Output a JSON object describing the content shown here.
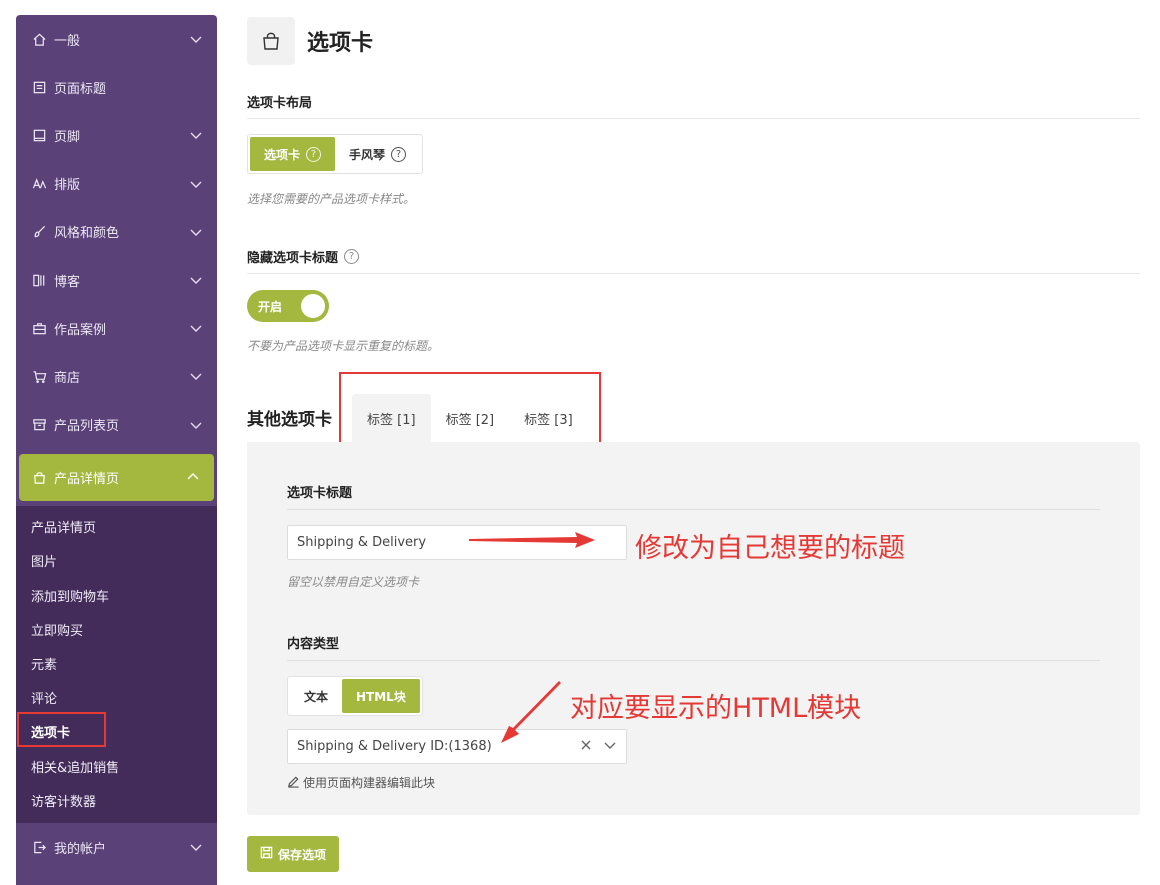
{
  "sidebar": {
    "items": [
      {
        "label": "一般",
        "icon": "home-icon"
      },
      {
        "label": "页面标题",
        "icon": "page-icon"
      },
      {
        "label": "页脚",
        "icon": "footer-icon"
      },
      {
        "label": "排版",
        "icon": "typography-icon"
      },
      {
        "label": "风格和颜色",
        "icon": "brush-icon"
      },
      {
        "label": "博客",
        "icon": "blog-icon"
      },
      {
        "label": "作品案例",
        "icon": "briefcase-icon"
      },
      {
        "label": "商店",
        "icon": "cart-icon"
      },
      {
        "label": "产品列表页",
        "icon": "archive-icon"
      },
      {
        "label": "产品详情页",
        "icon": "bag-icon"
      }
    ],
    "submenu": [
      "产品详情页",
      "图片",
      "添加到购物车",
      "立即购买",
      "元素",
      "评论",
      "选项卡",
      "相关&追加销售",
      "访客计数器"
    ],
    "bottom_item": {
      "label": "我的帐户",
      "icon": "account-icon"
    }
  },
  "page": {
    "title": "选项卡",
    "icon": "bag-icon"
  },
  "layout_section": {
    "label": "选项卡布局",
    "options": [
      "选项卡",
      "手风琴"
    ],
    "selected": "选项卡",
    "help": "选择您需要的产品选项卡样式。"
  },
  "hide_section": {
    "label": "隐藏选项卡标题",
    "toggle_label": "开启",
    "help": "不要为产品选项卡显示重复的标题。"
  },
  "other_tabs": {
    "title": "其他选项卡",
    "tabs": [
      "标签 [1]",
      "标签 [2]",
      "标签 [3]"
    ],
    "active_tab": "标签 [1]"
  },
  "panel": {
    "tab_title_label": "选项卡标题",
    "tab_title_value": "Shipping & Delivery",
    "tab_title_help": "留空以禁用自定义选项卡",
    "content_type_label": "内容类型",
    "content_types": [
      "文本",
      "HTML块"
    ],
    "content_type_selected": "HTML块",
    "block_select_value": "Shipping & Delivery ID:(1368)",
    "edit_link": "使用页面构建器编辑此块"
  },
  "annotations": {
    "title_note": "修改为自己想要的标题",
    "block_note": "对应要显示的HTML模块"
  },
  "save_button": "保存选项",
  "colors": {
    "sidebar_bg": "#5a4178",
    "submenu_bg": "#432c5a",
    "accent": "#a4b840",
    "annotation": "#e53935"
  }
}
